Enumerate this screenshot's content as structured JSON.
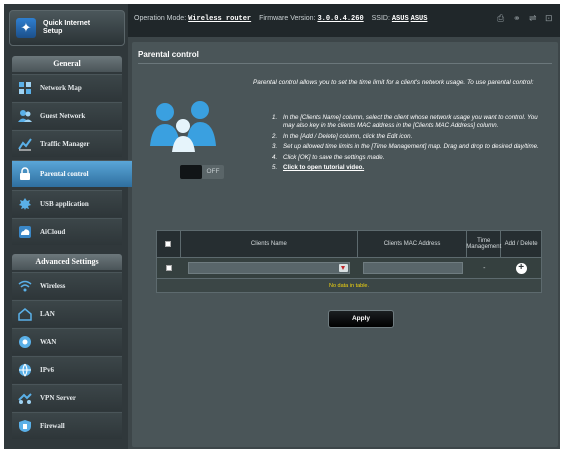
{
  "topbar": {
    "operation_mode_label": "Operation Mode:",
    "operation_mode_value": "Wireless router",
    "firmware_label": "Firmware Version:",
    "firmware_value": "3.0.0.4.260",
    "ssid_label": "SSID:",
    "ssid_values": [
      "ASUS",
      "ASUS"
    ]
  },
  "sidebar": {
    "quick_setup": "Quick Internet Setup",
    "general_header": "General",
    "general_items": [
      {
        "label": "Network Map",
        "icon": "network-map-icon"
      },
      {
        "label": "Guest Network",
        "icon": "guest-network-icon"
      },
      {
        "label": "Traffic Manager",
        "icon": "traffic-manager-icon"
      },
      {
        "label": "Parental control",
        "icon": "parental-control-icon",
        "active": true
      },
      {
        "label": "USB application",
        "icon": "usb-application-icon"
      },
      {
        "label": "AiCloud",
        "icon": "aicloud-icon"
      }
    ],
    "advanced_header": "Advanced Settings",
    "advanced_items": [
      {
        "label": "Wireless",
        "icon": "wireless-icon"
      },
      {
        "label": "LAN",
        "icon": "lan-icon"
      },
      {
        "label": "WAN",
        "icon": "wan-icon"
      },
      {
        "label": "IPv6",
        "icon": "ipv6-icon"
      },
      {
        "label": "VPN Server",
        "icon": "vpn-server-icon"
      },
      {
        "label": "Firewall",
        "icon": "firewall-icon"
      }
    ]
  },
  "main": {
    "title": "Parental control",
    "intro": "Parental control allows you to set the time limit for a client's network usage. To use parental control:",
    "steps": [
      {
        "num": "1.",
        "text": "In the [Clients Name] column, select the client whose network usage you want to control. You may also key in the clients MAC address in the [Clients MAC Address] column."
      },
      {
        "num": "2.",
        "text": "In the [Add / Delete] column, click the Edit icon."
      },
      {
        "num": "3.",
        "text": "Set up allowed time limits in the [Time Management] map. Drag and drop to desired day/time."
      },
      {
        "num": "4.",
        "text": "Click [OK] to save the settings made."
      },
      {
        "num": "5.",
        "text": "Click to open tutorial video."
      }
    ],
    "toggle_state": "OFF",
    "table": {
      "headers": [
        "Clients Name",
        "Clients MAC Address",
        "Time Management",
        "Add / Delete"
      ],
      "row_time_value": "-",
      "empty_message": "No data in table."
    },
    "apply_label": "Apply"
  },
  "colors": {
    "background": "#3d4649",
    "accent_active": "#4a94c8",
    "empty_message": "#f2d40f"
  }
}
